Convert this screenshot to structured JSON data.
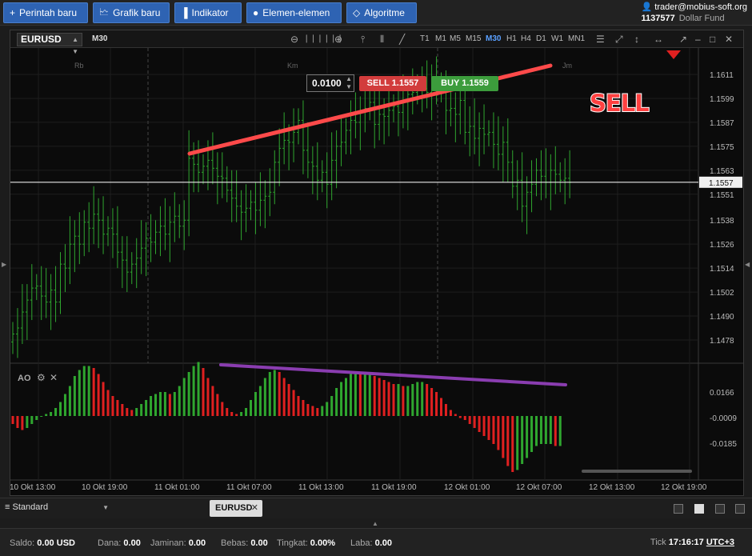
{
  "toolbar": {
    "new_order": "Perintah baru",
    "new_chart": "Grafik baru",
    "indicator": "Indikator",
    "elements": "Elemen-elemen",
    "algorithm": "Algoritme"
  },
  "user": {
    "email": "trader@mobius-soft.org",
    "account": "1137577",
    "fund": "Dollar Fund"
  },
  "chart": {
    "symbol": "EURUSD",
    "timeframe": "M30",
    "timeframes": [
      "T1",
      "M1",
      "M5",
      "M15",
      "M30",
      "H1",
      "H4",
      "D1",
      "W1",
      "MN1"
    ],
    "active_timeframe": "M30",
    "session_labels": [
      "Rb",
      "Km",
      "Jm"
    ],
    "lot": "0.0100",
    "sell_label": "SELL",
    "sell_price": "1.1557",
    "buy_label": "BUY",
    "buy_price": "1.1559",
    "annotation": "SELL",
    "indicator_name": "AO",
    "colors": {
      "up": "#2fa62f",
      "down": "#e02020",
      "trend_price": "#ff4a4a",
      "trend_ao": "#8a3db0",
      "sell": "#d23c3c",
      "buy": "#3c9c3c"
    }
  },
  "chart_data": {
    "type": "bar",
    "price_axis_ticks": [
      "1.1611",
      "1.1599",
      "1.1587",
      "1.1575",
      "1.1563",
      "1.1551",
      "1.1538",
      "1.1526",
      "1.1514",
      "1.1502",
      "1.1490",
      "1.1478"
    ],
    "current_price": "1.1557",
    "ao_axis_ticks": [
      "0.0166",
      "-0.0009",
      "-0.0185"
    ],
    "time_labels": [
      "10 Okt 13:00",
      "10 Okt 19:00",
      "11 Okt 01:00",
      "11 Okt 07:00",
      "11 Okt 13:00",
      "11 Okt 19:00",
      "12 Okt 01:00",
      "12 Okt 07:00",
      "12 Okt 13:00",
      "12 Okt 19:00"
    ],
    "ylim": [
      1.147,
      1.162
    ],
    "close": [
      1.1481,
      1.1484,
      1.1492,
      1.1498,
      1.1504,
      1.1505,
      1.15,
      1.1497,
      1.1503,
      1.1497,
      1.1516,
      1.1514,
      1.1526,
      1.153,
      1.1526,
      1.1537,
      1.1534,
      1.1541,
      1.1538,
      1.1531,
      1.1534,
      1.1531,
      1.1522,
      1.1518,
      1.1512,
      1.1516,
      1.1519,
      1.1524,
      1.1529,
      1.1527,
      1.1532,
      1.1535,
      1.1531,
      1.1537,
      1.154,
      1.1535,
      1.1538,
      1.1569,
      1.1566,
      1.1562,
      1.1565,
      1.1568,
      1.1564,
      1.156,
      1.1559,
      1.1553,
      1.1549,
      1.1545,
      1.1542,
      1.1544,
      1.1547,
      1.1543,
      1.1548,
      1.155,
      1.1552,
      1.1567,
      1.1574,
      1.1578,
      1.1577,
      1.1582,
      1.1588,
      1.1573,
      1.1567,
      1.1565,
      1.1558,
      1.1562,
      1.1556,
      1.1568,
      1.1575,
      1.1577,
      1.1583,
      1.1588,
      1.1587,
      1.1592,
      1.1594,
      1.1597,
      1.1586,
      1.1591,
      1.159,
      1.1593,
      1.1595,
      1.1592,
      1.1597,
      1.1601,
      1.1602,
      1.1605,
      1.1604,
      1.1602,
      1.1608,
      1.1606,
      1.1603,
      1.1593,
      1.1594,
      1.1591,
      1.1598,
      1.1582,
      1.1585,
      1.1579,
      1.1584,
      1.1581,
      1.1582,
      1.1576,
      1.1571,
      1.1577,
      1.1567,
      1.1555,
      1.1558,
      1.1545,
      1.1552,
      1.1556,
      1.1563,
      1.156,
      1.1557,
      1.1563,
      1.1561,
      1.1558,
      1.1559,
      1.1557
    ],
    "ao": [
      -0.004,
      -0.006,
      -0.007,
      -0.006,
      -0.004,
      -0.002,
      0,
      0.001,
      0.002,
      0.004,
      0.007,
      0.011,
      0.015,
      0.02,
      0.023,
      0.025,
      0.025,
      0.024,
      0.021,
      0.017,
      0.013,
      0.01,
      0.008,
      0.006,
      0.004,
      0.003,
      0.004,
      0.006,
      0.008,
      0.01,
      0.011,
      0.012,
      0.012,
      0.011,
      0.012,
      0.015,
      0.019,
      0.022,
      0.025,
      0.027,
      0.024,
      0.019,
      0.015,
      0.011,
      0.007,
      0.004,
      0.002,
      0.001,
      0.002,
      0.004,
      0.008,
      0.012,
      0.015,
      0.019,
      0.022,
      0.023,
      0.022,
      0.019,
      0.016,
      0.013,
      0.01,
      0.008,
      0.006,
      0.005,
      0.004,
      0.005,
      0.007,
      0.01,
      0.014,
      0.017,
      0.019,
      0.021,
      0.022,
      0.021,
      0.021,
      0.021,
      0.02,
      0.019,
      0.018,
      0.017,
      0.016,
      0.016,
      0.015,
      0.015,
      0.016,
      0.017,
      0.017,
      0.016,
      0.014,
      0.012,
      0.009,
      0.006,
      0.003,
      0.001,
      -0.001,
      -0.002,
      -0.004,
      -0.006,
      -0.008,
      -0.01,
      -0.012,
      -0.014,
      -0.017,
      -0.021,
      -0.025,
      -0.028,
      -0.027,
      -0.024,
      -0.021,
      -0.018,
      -0.015,
      -0.014,
      -0.014,
      -0.014,
      -0.015,
      -0.015
    ]
  },
  "bottom": {
    "layout_name": "Standard",
    "tab_name": "EURUSD"
  },
  "status": {
    "saldo_label": "Saldo:",
    "saldo_value": "0.00",
    "saldo_currency": "USD",
    "dana_label": "Dana:",
    "dana_value": "0.00",
    "jaminan_label": "Jaminan:",
    "jaminan_value": "0.00",
    "bebas_label": "Bebas:",
    "bebas_value": "0.00",
    "tingkat_label": "Tingkat:",
    "tingkat_value": "0.00%",
    "laba_label": "Laba:",
    "laba_value": "0.00",
    "tick_label": "Tick",
    "time": "17:16:17",
    "timezone": "UTC+3"
  }
}
